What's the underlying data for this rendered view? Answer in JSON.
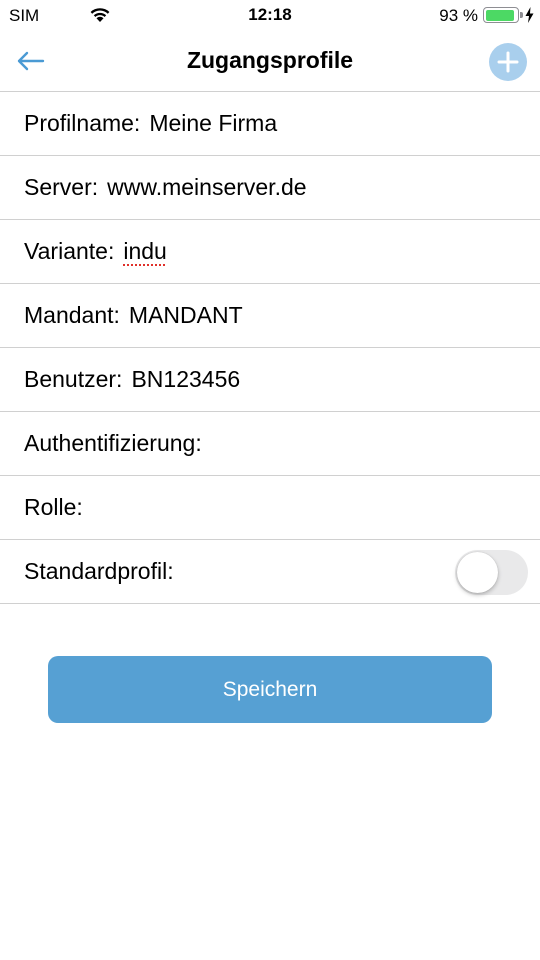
{
  "status_bar": {
    "carrier": "SIM",
    "time": "12:18",
    "battery_percent": "93 %",
    "battery_level": 0.93,
    "battery_color": "#4cd964",
    "icons": [
      "wifi-icon",
      "battery-icon",
      "charging-bolt-icon"
    ]
  },
  "nav": {
    "title": "Zugangsprofile",
    "back_icon": "arrow-left-icon",
    "add_icon": "plus-circle-icon",
    "accent_color": "#56a0d3"
  },
  "fields": [
    {
      "label": "Profilname:",
      "value": "Meine Firma"
    },
    {
      "label": "Server:",
      "value": "www.meinserver.de"
    },
    {
      "label": "Variante:",
      "value": "indu"
    },
    {
      "label": "Mandant:",
      "value": "MANDANT"
    },
    {
      "label": "Benutzer:",
      "value": "BN123456"
    },
    {
      "label": "Authentifizierung:",
      "value": ""
    },
    {
      "label": "Rolle:",
      "value": ""
    }
  ],
  "standard_profile": {
    "label": "Standardprofil:",
    "enabled": false
  },
  "save_label": "Speichern"
}
